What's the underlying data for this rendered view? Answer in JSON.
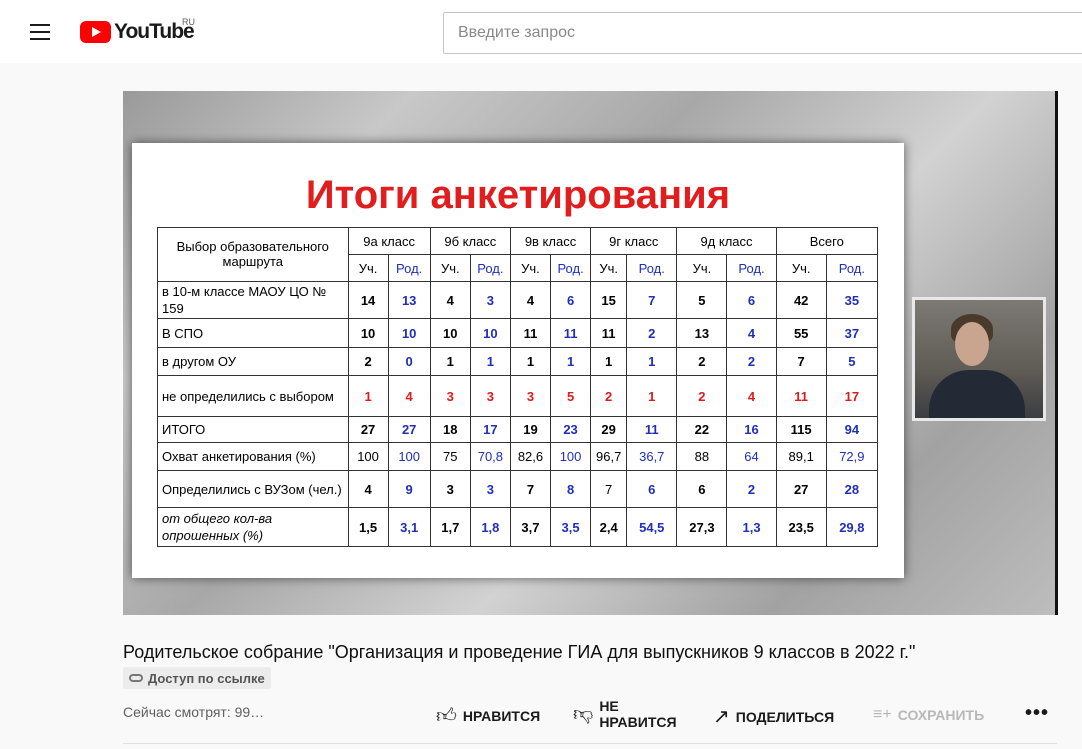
{
  "header": {
    "logo_text": "YouTube",
    "country_code": "RU",
    "search_placeholder": "Введите запрос"
  },
  "slide": {
    "title": "Итоги анкетирования",
    "table": {
      "corner_label": "Выбор образовательного маршрута",
      "class_headers": [
        "9а класс",
        "9б класс",
        "9в класс",
        "9г класс",
        "9д класс",
        "Всего"
      ],
      "sub_headers": [
        "Уч.",
        "Род.",
        "Уч.",
        "Род.",
        "Уч.",
        "Род.",
        "Уч.",
        "Род.",
        "Уч.",
        "Род.",
        "Уч.",
        "Род."
      ],
      "rows": [
        {
          "label": "в 10-м классе МАОУ ЦО № 159",
          "values": [
            "14",
            "13",
            "4",
            "3",
            "4",
            "6",
            "15",
            "7",
            "5",
            "6",
            "42",
            "35"
          ]
        },
        {
          "label": "В СПО",
          "values": [
            "10",
            "10",
            "10",
            "10",
            "11",
            "11",
            "11",
            "2",
            "13",
            "4",
            "55",
            "37"
          ]
        },
        {
          "label": "в другом ОУ",
          "values": [
            "2",
            "0",
            "1",
            "1",
            "1",
            "1",
            "1",
            "1",
            "2",
            "2",
            "7",
            "5"
          ]
        },
        {
          "label": "не определились с выбором",
          "values": [
            "1",
            "4",
            "3",
            "3",
            "3",
            "5",
            "2",
            "1",
            "2",
            "4",
            "11",
            "17"
          ]
        },
        {
          "label": "ИТОГО",
          "values": [
            "27",
            "27",
            "18",
            "17",
            "19",
            "23",
            "29",
            "11",
            "22",
            "16",
            "115",
            "94"
          ]
        },
        {
          "label": "Охват анкетирования (%)",
          "values": [
            "100",
            "100",
            "75",
            "70,8",
            "82,6",
            "100",
            "96,7",
            "36,7",
            "88",
            "64",
            "89,1",
            "72,9"
          ]
        },
        {
          "label": "Определились с ВУЗом (чел.)",
          "values": [
            "4",
            "9",
            "3",
            "3",
            "7",
            "8",
            "7",
            "6",
            "6",
            "2",
            "27",
            "28"
          ]
        },
        {
          "label": "от общего кол-ва опрошенных (%)",
          "values": [
            "1,5",
            "3,1",
            "1,7",
            "1,8",
            "3,7",
            "3,5",
            "2,4",
            "54,5",
            "27,3",
            "1,3",
            "23,5",
            "29,8"
          ]
        }
      ]
    }
  },
  "video": {
    "title": "Родительское собрание \"Организация и проведение ГИА для выпускников 9 классов в 2022 г.\"",
    "access_badge": "Доступ по ссылке",
    "viewers": "Сейчас смотрят: 99…"
  },
  "actions": {
    "like": "НРАВИТСЯ",
    "dislike_line1": "НЕ",
    "dislike_line2": "НРАВИТСЯ",
    "share": "ПОДЕЛИТЬСЯ",
    "save": "СОХРАНИТЬ",
    "more": "•••"
  },
  "colors": {
    "brand_red": "#ff0000",
    "slide_title": "#e11d1d",
    "parent_values": "#1f2fb8",
    "undecided_values": "#e01b1b"
  },
  "icons": [
    "menu-icon",
    "youtube-logo",
    "link-icon",
    "thumb-up-icon",
    "thumb-down-icon",
    "share-icon",
    "add-to-playlist-icon",
    "more-icon"
  ]
}
